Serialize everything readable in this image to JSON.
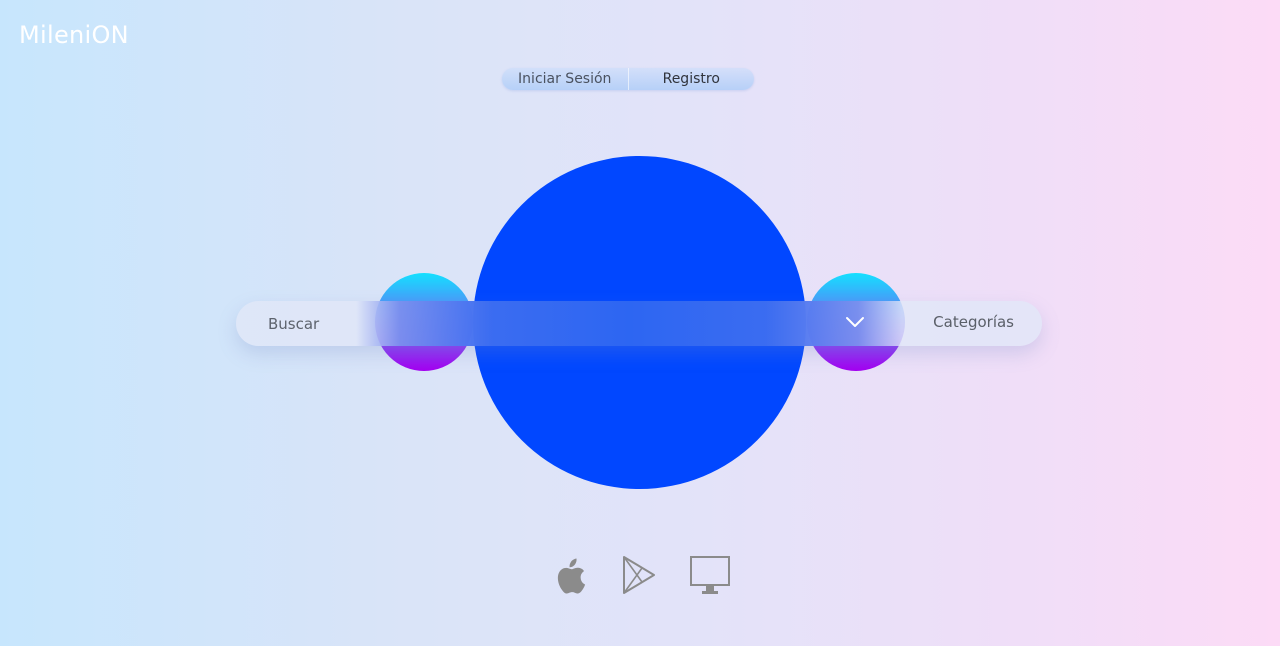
{
  "brand": {
    "name": "MileniON"
  },
  "auth": {
    "login_label": "Iniciar Sesión",
    "register_label": "Registro"
  },
  "search": {
    "placeholder": "Buscar",
    "value": "",
    "categories_label": "Categorías"
  },
  "platforms": [
    {
      "icon": "apple-icon"
    },
    {
      "icon": "google-play-icon"
    },
    {
      "icon": "desktop-icon"
    }
  ],
  "colors": {
    "main_circle": "#0147ff",
    "side_circle_top": "#14e0ff",
    "side_circle_bottom": "#a400f0",
    "logo": "#ffffff"
  }
}
